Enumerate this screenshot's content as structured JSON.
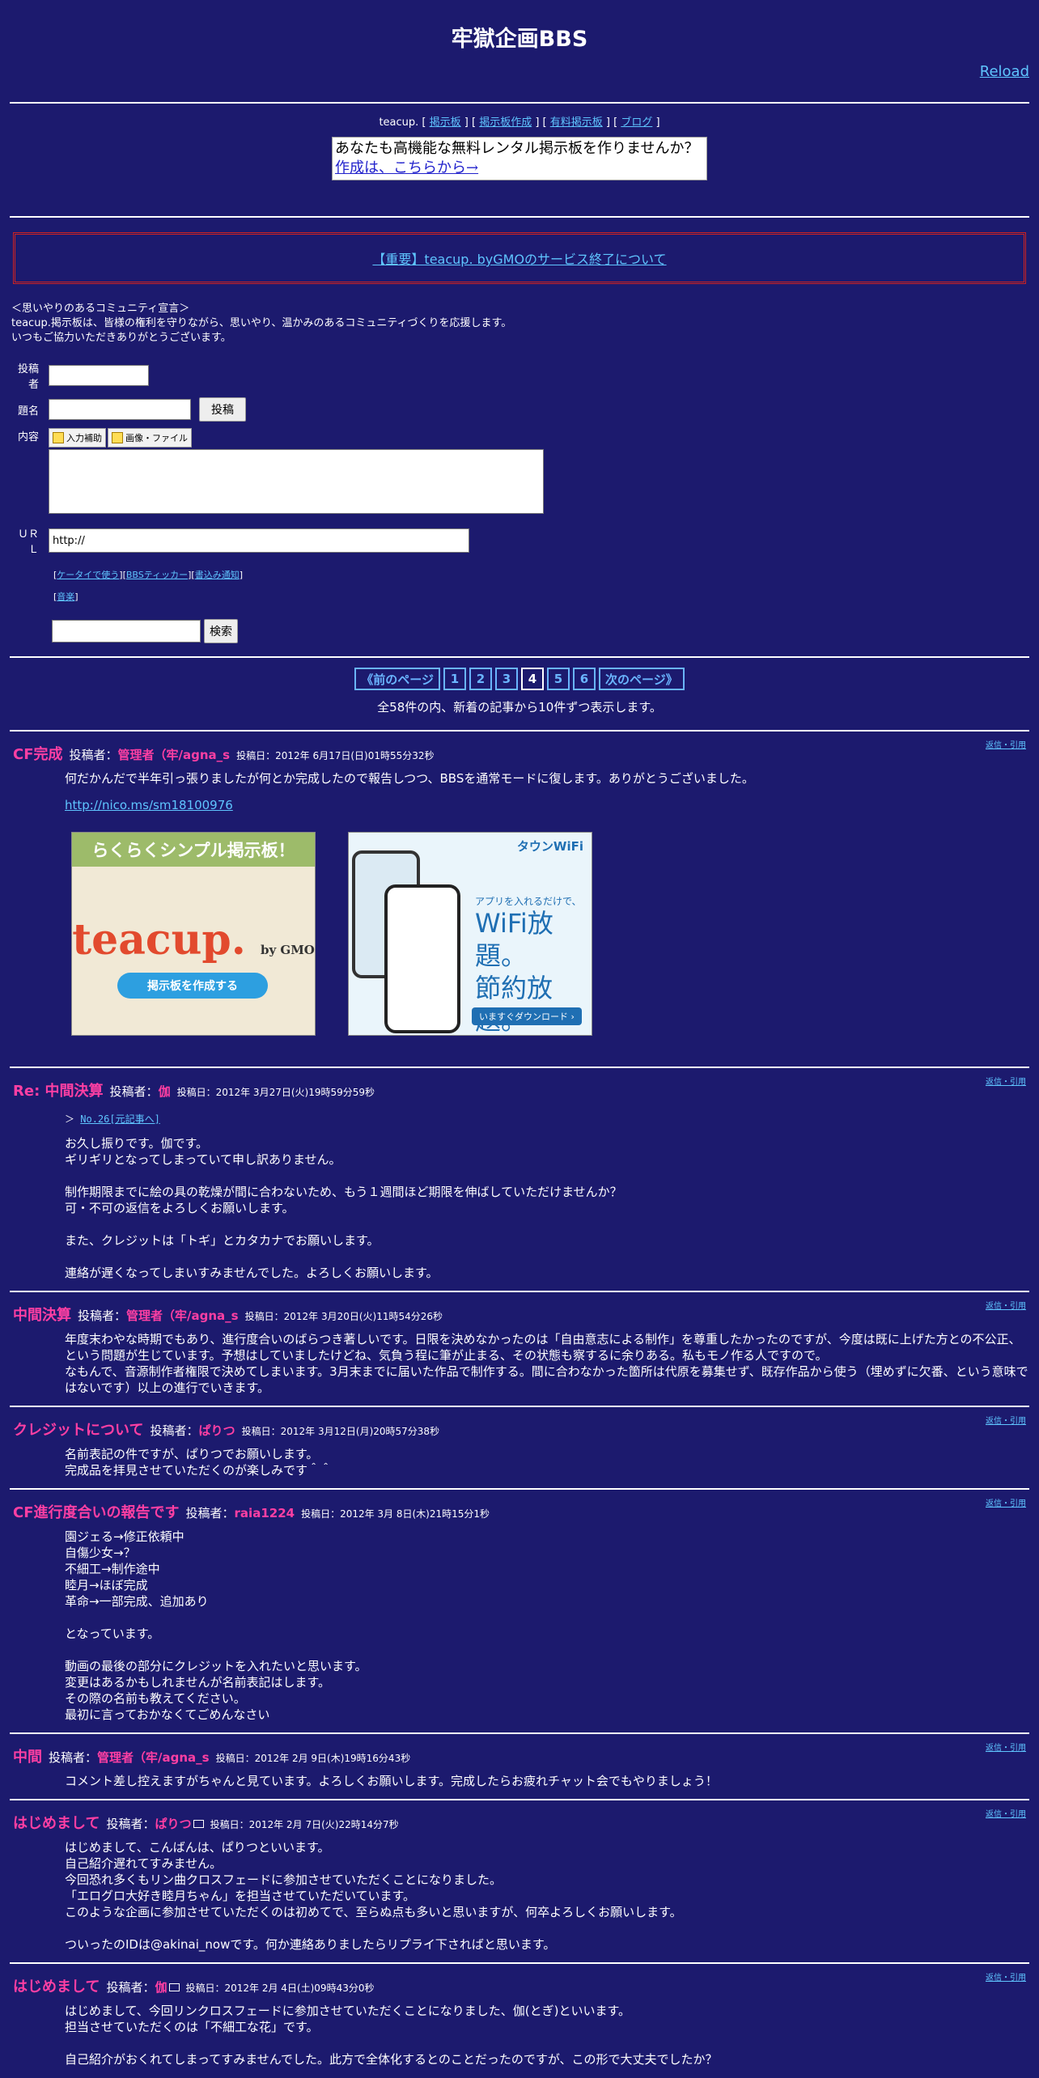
{
  "page": {
    "title": "牢獄企画BBS",
    "reload": "Reload"
  },
  "top_links": {
    "prefix": "teacup. [",
    "items": [
      "掲示板",
      "掲示板作成",
      "有料掲示板",
      "ブログ"
    ],
    "seps": [
      " ] [ ",
      " ] [ ",
      " ] [ "
    ],
    "suffix": " ]"
  },
  "ad": {
    "line1": "あなたも高機能な無料レンタル掲示板を作りませんか？",
    "line2": "作成は、こちらから→"
  },
  "notice": "【重要】teacup. byGMOのサービス終了について",
  "declaration": [
    "＜思いやりのあるコミュニティ宣言＞",
    "teacup.掲示板は、皆様の権利を守りながら、思いやり、温かみのあるコミュニティづくりを応援します。",
    "いつもご協力いただきありがとうございます。"
  ],
  "form": {
    "name_label": "投稿者",
    "subject_label": "題名",
    "submit_label": "投稿",
    "content_label": "内容",
    "tool1": "入力補助",
    "tool2": "画像・ファイル",
    "url_label": "ＵＲＬ",
    "url_value": "http://",
    "links": [
      "ケータイで使う",
      "BBSティッカー",
      "書込み通知"
    ],
    "music": "音楽",
    "search_label": "検索"
  },
  "pager": {
    "prev": "《前のページ",
    "pages": [
      "1",
      "2",
      "3",
      "4",
      "5",
      "6"
    ],
    "current": "4",
    "next": "次のページ》",
    "summary": "全58件の内、新着の記事から10件ずつ表示します。"
  },
  "posts": [
    {
      "title": "CF完成",
      "author_prefix": "投稿者：",
      "author": "管理者（牢/agna_s",
      "date": "投稿日：2012年 6月17日(日)01時55分32秒",
      "reply": "返信・引用",
      "body": "何だかんだで半年引っ張りましたが何とか完成したので報告しつつ、BBSを通常モードに復します。ありがとうございました。",
      "link": "http://nico.ms/sm18100976"
    },
    {
      "title": "Re: 中間決算",
      "author_prefix": "投稿者：",
      "author": "伽",
      "date": "投稿日：2012年 3月27日(火)19時59分59秒",
      "reply": "返信・引用",
      "quote_prefix": "＞",
      "quote": "No.26[元記事へ]",
      "body": "お久し振りです。伽です。\nギリギリとなってしまっていて申し訳ありません。\n\n制作期限までに絵の具の乾燥が間に合わないため、もう１週間ほど期限を伸ばしていただけませんか？\n可・不可の返信をよろしくお願いします。\n\nまた、クレジットは「トギ」とカタカナでお願いします。\n\n連絡が遅くなってしまいすみませんでした。よろしくお願いします。"
    },
    {
      "title": "中間決算",
      "author_prefix": "投稿者：",
      "author": "管理者（牢/agna_s",
      "date": "投稿日：2012年 3月20日(火)11時54分26秒",
      "reply": "返信・引用",
      "body": "年度末わやな時期でもあり、進行度合いのばらつき著しいです。日限を決めなかったのは「自由意志による制作」を尊重したかったのですが、今度は既に上げた方との不公正、という問題が生じています。予想はしていましたけどね、気負う程に筆が止まる、その状態も察するに余りある。私もモノ作る人ですので。\nなもんで、音源制作者権限で決めてしまいます。3月末までに届いた作品で制作する。間に合わなかった箇所は代原を募集せず、既存作品から使う（埋めずに欠番、という意味ではないです）以上の進行でいきます。"
    },
    {
      "title": "クレジットについて",
      "author_prefix": "投稿者：",
      "author": "ぱりつ",
      "date": "投稿日：2012年 3月12日(月)20時57分38秒",
      "reply": "返信・引用",
      "body": "名前表記の件ですが、ぱりつでお願いします。\n完成品を拝見させていただくのが楽しみです＾＾"
    },
    {
      "title": "CF進行度合いの報告です",
      "author_prefix": "投稿者：",
      "author": "raia1224",
      "date": "投稿日：2012年 3月 8日(木)21時15分1秒",
      "reply": "返信・引用",
      "body": "園ジェる→修正依頼中\n自傷少女→？\n不細工→制作途中\n睦月→ほぼ完成\n革命→一部完成、追加あり\n\nとなっています。\n\n動画の最後の部分にクレジットを入れたいと思います。\n変更はあるかもしれませんが名前表記はします。\nその際の名前も教えてください。\n最初に言っておかなくてごめんなさい"
    },
    {
      "title": "中間",
      "author_prefix": "投稿者：",
      "author": "管理者（牢/agna_s",
      "date": "投稿日：2012年 2月 9日(木)19時16分43秒",
      "reply": "返信・引用",
      "body": "コメント差し控えますがちゃんと見ています。よろしくお願いします。完成したらお疲れチャット会でもやりましょう！"
    },
    {
      "title": "はじめまして",
      "author_prefix": "投稿者：",
      "author": "ぱりつ",
      "date": "投稿日：2012年 2月 7日(火)22時14分7秒",
      "reply": "返信・引用",
      "body": "はじめまして、こんばんは、ぱりつといいます。\n自己紹介遅れてすみません。\n今回恐れ多くもリン曲クロスフェードに参加させていただくことになりました。\n「エログロ大好き睦月ちゃん」を担当させていただいています。\nこのような企画に参加させていただくのは初めてで、至らぬ点も多いと思いますが、何卒よろしくお願いします。\n\nついったのIDは@akinai_nowです。何か連絡ありましたらリプライ下さればと思います。"
    },
    {
      "title": "はじめまして",
      "author_prefix": "投稿者：",
      "author": "伽",
      "date": "投稿日：2012年 2月 4日(土)09時43分0秒",
      "reply": "返信・引用",
      "body": "はじめまして、今回リンクロスフェードに参加させていただくことになりました、伽(とぎ)といいます。\n担当させていただくのは「不細工な花」です。\n\n自己紹介がおくれてしまってすみませんでした。此方で全体化するとのことだったのですが、この形で大丈夫でしたか？"
    }
  ],
  "banners": {
    "b1_top": "らくらくシンプル掲示板！",
    "b1_logo": "teacup.",
    "b1_by": "by GMO",
    "b1_cta": "掲示板を作成する",
    "b2_logo": "タウンWiFi",
    "b2_t1": "アプリを入れるだけで、",
    "b2_t2a": "WiFi放題。",
    "b2_t2b": "節約放題。",
    "b2_cta": "いますぐダウンロード ›"
  },
  "colors": {
    "background": "#1c1a6e",
    "accent_pink": "#ff3fa3",
    "link": "#5fc5ff"
  }
}
